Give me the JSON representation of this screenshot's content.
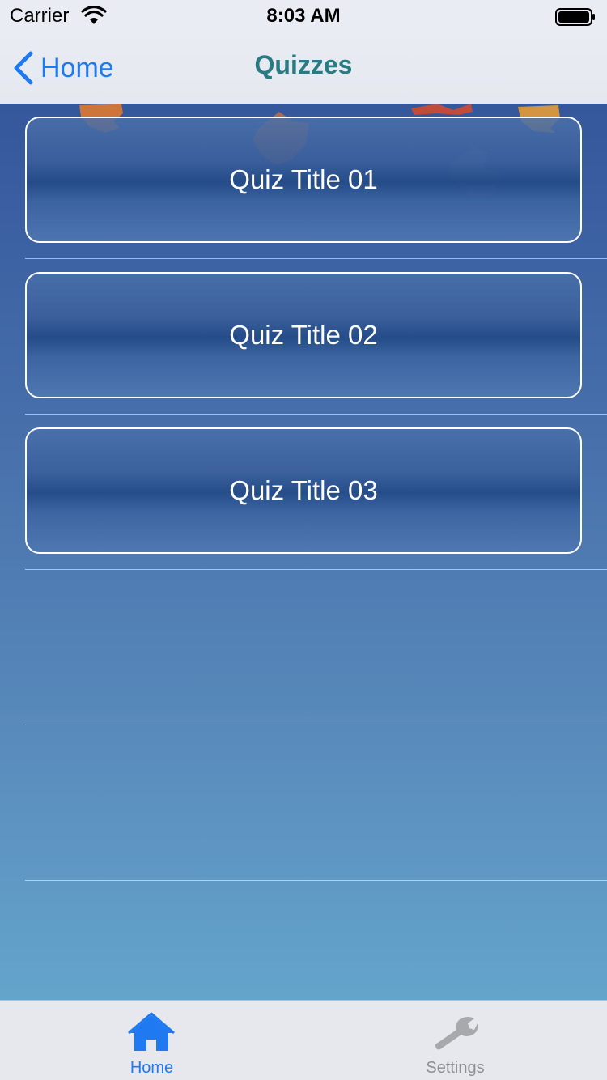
{
  "status_bar": {
    "carrier": "Carrier",
    "time": "8:03 AM",
    "wifi_icon": "wifi-icon",
    "battery_icon": "battery-icon"
  },
  "nav": {
    "back_label": "Home",
    "back_icon": "chevron-left-icon",
    "title": "Quizzes"
  },
  "quizzes": [
    {
      "title": "Quiz Title 01"
    },
    {
      "title": "Quiz Title 02"
    },
    {
      "title": "Quiz Title 03"
    }
  ],
  "tab_bar": {
    "tabs": [
      {
        "label": "Home",
        "icon": "home-icon",
        "selected": true
      },
      {
        "label": "Settings",
        "icon": "wrench-icon",
        "selected": false
      }
    ]
  },
  "colors": {
    "accent": "#1f7af2",
    "title": "#2a7a83",
    "inactive_tab": "#8e8e93"
  }
}
